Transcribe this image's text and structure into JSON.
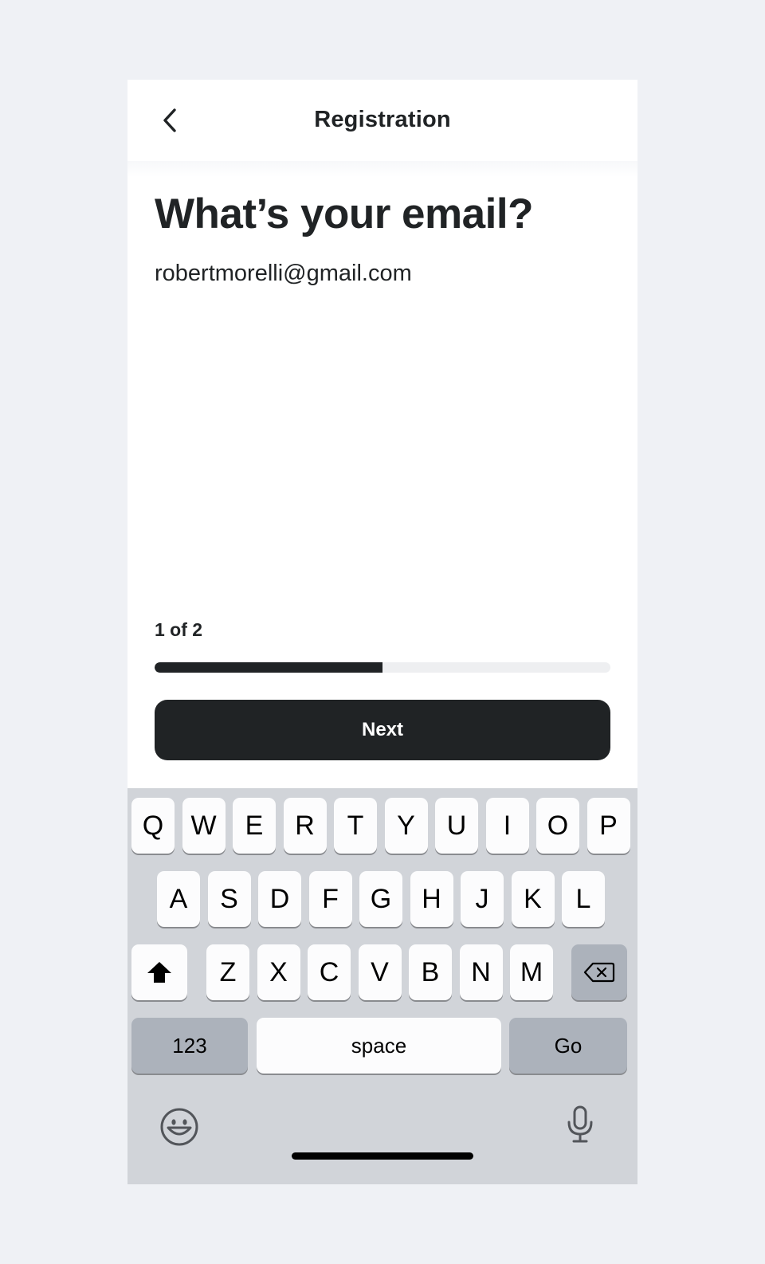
{
  "header": {
    "title": "Registration",
    "back_icon": "chevron-left-icon"
  },
  "main": {
    "headline": "What’s your email?",
    "email_value": "robertmorelli@gmail.com",
    "step_label": "1 of 2",
    "progress_fraction": 0.5,
    "next_label": "Next"
  },
  "keyboard": {
    "row1": [
      "Q",
      "W",
      "E",
      "R",
      "T",
      "Y",
      "U",
      "I",
      "O",
      "P"
    ],
    "row2": [
      "A",
      "S",
      "D",
      "F",
      "G",
      "H",
      "J",
      "K",
      "L"
    ],
    "row3": [
      "Z",
      "X",
      "C",
      "V",
      "B",
      "N",
      "M"
    ],
    "numbers_label": "123",
    "space_label": "space",
    "go_label": "Go",
    "shift_icon": "shift-icon",
    "delete_icon": "delete-icon",
    "emoji_icon": "emoji-icon",
    "mic_icon": "microphone-icon"
  },
  "colors": {
    "primary": "#202325",
    "keyboard_bg": "#d1d4d9",
    "key_dark": "#acb2bb",
    "page_bg": "#eff1f5"
  }
}
